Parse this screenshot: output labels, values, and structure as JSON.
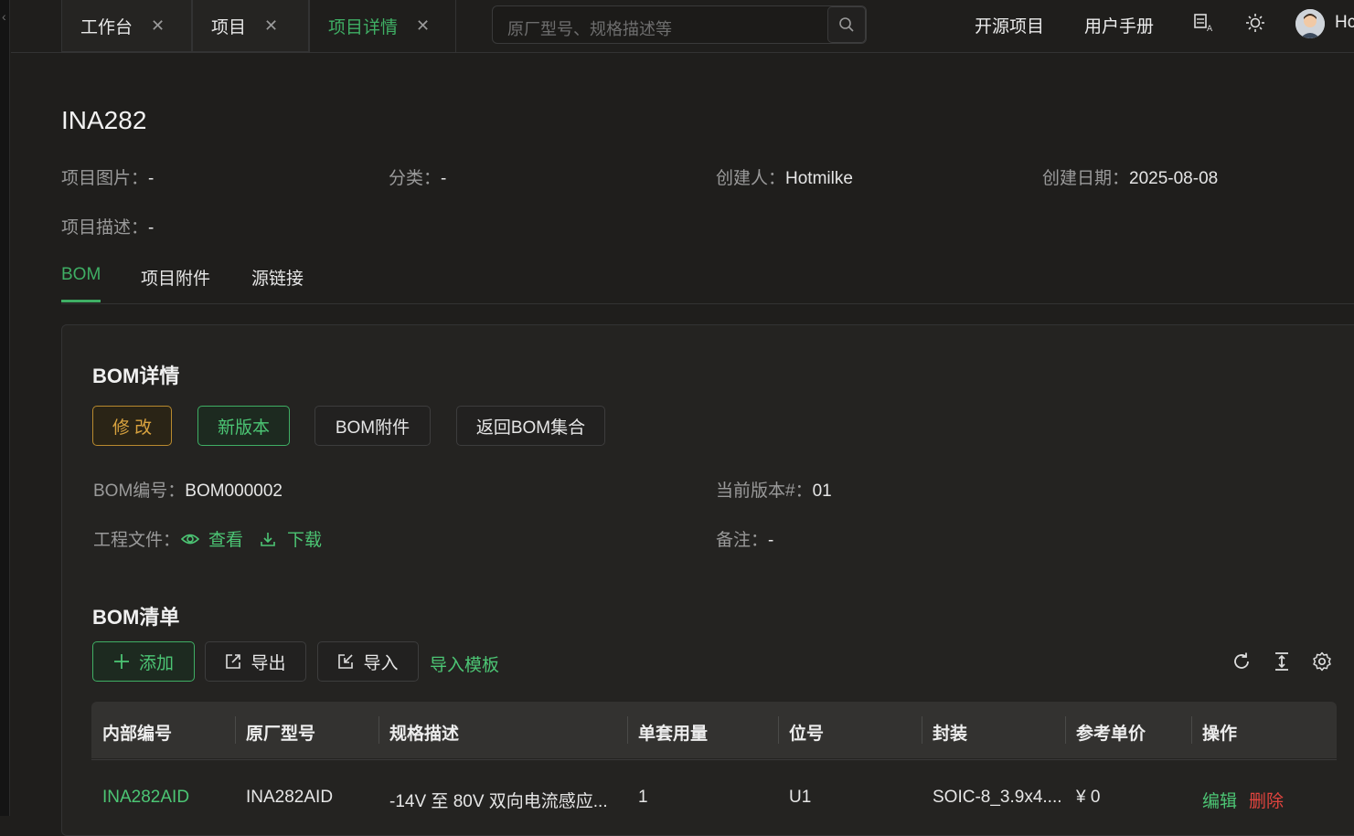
{
  "tabs": [
    {
      "label": "工作台"
    },
    {
      "label": "项目"
    },
    {
      "label": "项目详情"
    }
  ],
  "search": {
    "placeholder": "原厂型号、规格描述等"
  },
  "nav": {
    "open_source": "开源项目",
    "manual": "用户手册",
    "user": "Hc"
  },
  "project": {
    "title": "INA282",
    "image_label": "项目图片：",
    "image_value": "-",
    "category_label": "分类：",
    "category_value": "-",
    "creator_label": "创建人：",
    "creator_value": "Hotmilke",
    "date_label": "创建日期：",
    "date_value": "2025-08-08",
    "desc_label": "项目描述：",
    "desc_value": "-"
  },
  "detail_tabs": [
    "BOM",
    "项目附件",
    "源链接"
  ],
  "bom": {
    "title": "BOM详情",
    "buttons": {
      "edit": "修 改",
      "new_version": "新版本",
      "attachments": "BOM附件",
      "back": "返回BOM集合"
    },
    "number_label": "BOM编号：",
    "number_value": "BOM000002",
    "version_label": "当前版本#：",
    "version_value": "01",
    "files_label": "工程文件：",
    "view": "查看",
    "download": "下载",
    "remark_label": "备注：",
    "remark_value": "-"
  },
  "list": {
    "title": "BOM清单",
    "add": "添加",
    "export": "导出",
    "import": "导入",
    "template": "导入模板",
    "columns": [
      "内部编号",
      "原厂型号",
      "规格描述",
      "单套用量",
      "位号",
      "封装",
      "参考单价",
      "操作"
    ],
    "rows": [
      {
        "internal": "INA282AID",
        "mfr": "INA282AID",
        "spec": "-14V 至 80V 双向电流感应...",
        "qty": "1",
        "ref": "U1",
        "package": "SOIC-8_3.9x4....",
        "price": "¥ 0",
        "edit": "编辑",
        "delete": "删除"
      }
    ]
  },
  "colors": {
    "accent": "#3fae64",
    "warning": "#d9a33f",
    "danger": "#e0443e"
  }
}
